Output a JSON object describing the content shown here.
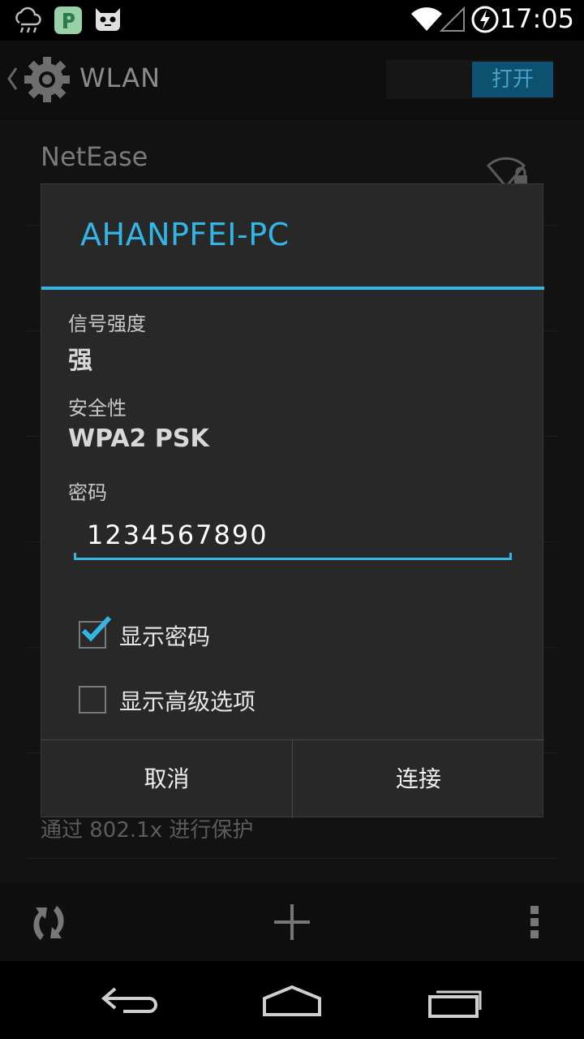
{
  "status_bar": {
    "time": "17:05",
    "icons": [
      "weather-cloud-rain-icon",
      "pushbullet-app-icon",
      "cyanogenmod-mascot-icon",
      "wifi-signal-icon",
      "cell-signal-icon",
      "battery-charging-icon"
    ]
  },
  "action_bar": {
    "title": "WLAN",
    "toggle_label": "打开"
  },
  "background_list": {
    "first_network": "NetEase",
    "secured_hint": "通过 802.1x 进行保护"
  },
  "dialog": {
    "title": "AHANPFEI-PC",
    "signal_label": "信号强度",
    "signal_value": "强",
    "security_label": "安全性",
    "security_value": "WPA2 PSK",
    "password_label": "密码",
    "password_value": "1234567890",
    "show_password_label": "显示密码",
    "show_password_checked": true,
    "show_advanced_label": "显示高级选项",
    "show_advanced_checked": false,
    "cancel_label": "取消",
    "connect_label": "连接"
  },
  "colors": {
    "accent": "#33b5e5",
    "dialog_bg": "#282828"
  }
}
